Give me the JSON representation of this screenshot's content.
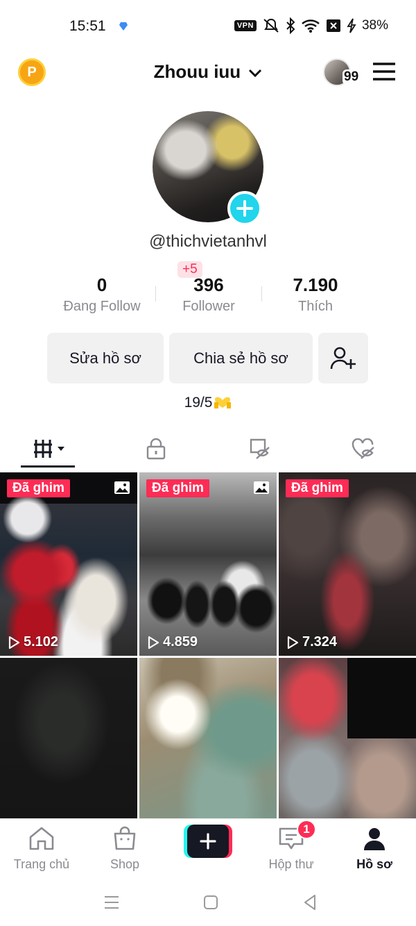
{
  "status_bar": {
    "time": "15:51",
    "vpn_label": "VPN",
    "battery": "38%"
  },
  "header": {
    "title": "Zhouu iuu",
    "story_count": "99",
    "coin_letter": "P"
  },
  "profile": {
    "username": "@thichvietanhvl",
    "stats": [
      {
        "value": "0",
        "label": "Đang Follow"
      },
      {
        "value": "396",
        "label": "Follower"
      },
      {
        "value": "7.190",
        "label": "Thích"
      }
    ],
    "new_followers": "+5",
    "actions": {
      "edit": "Sửa hồ sơ",
      "share": "Chia sẻ hồ sơ"
    },
    "bio": "19/5"
  },
  "tabs": [
    "videos-tab",
    "private-tab",
    "reposts-tab",
    "liked-tab"
  ],
  "grid": {
    "pin_label": "Đã ghim",
    "videos": [
      {
        "pinned": true,
        "views": "5.102"
      },
      {
        "pinned": true,
        "views": "4.859"
      },
      {
        "pinned": true,
        "views": "7.324"
      },
      {
        "pinned": false,
        "views": ""
      },
      {
        "pinned": false,
        "views": ""
      },
      {
        "pinned": false,
        "views": ""
      }
    ]
  },
  "bottom_nav": {
    "items": [
      {
        "label": "Trang chủ"
      },
      {
        "label": "Shop"
      },
      {
        "label": ""
      },
      {
        "label": "Hộp thư"
      },
      {
        "label": "Hồ sơ"
      }
    ],
    "inbox_badge": "1"
  },
  "colors": {
    "accent": "#fe2c55",
    "cyan": "#20d5ec",
    "text": "#161823",
    "muted": "#8a8b91"
  }
}
